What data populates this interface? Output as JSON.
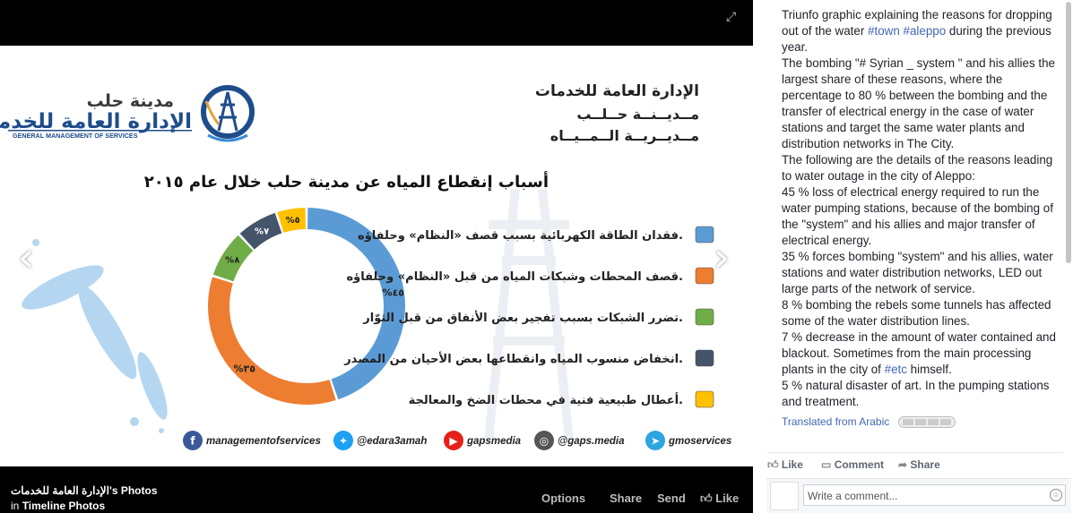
{
  "viewer": {
    "expand_icon": "expand-icon",
    "slide": {
      "brand_ar": "مدينة حلب",
      "brand_main_ar": "الإدارة العامة للخدمات",
      "brand_en": "GENERAL MANAGEMENT OF SERVICES",
      "header_lines": [
        "الإدارة العامة للخدمات",
        "مــديــنــة حــلــب",
        "مــديــريــة الــمــيــاه"
      ],
      "title": "أسباب إنقطاع المياه عن مدينة حلب خلال عام ٢٠١٥",
      "legend": [
        {
          "label": "فقدان الطاقة الكهربائية بسبب قصف «النظام» وحلفاؤه.",
          "color": "#5b9bd5"
        },
        {
          "label": "قصف المحطات وشبكات المياه من قبل «النظام» وحلفاؤه.",
          "color": "#ed7d31"
        },
        {
          "label": "تضرر الشبكات بسبب تفجير بعض الأنفاق من قبل الثوّار.",
          "color": "#70ad47"
        },
        {
          "label": "انخفاض منسوب المياه وانقطاعها بعض الأحيان من المصدر.",
          "color": "#44546a"
        },
        {
          "label": "أعطال طبيعية فنية في محطات الضخ والمعالجة.",
          "color": "#ffc000"
        }
      ],
      "social": [
        {
          "icon": "facebook-icon",
          "handle": "managementofservices",
          "color": "#3b5998"
        },
        {
          "icon": "twitter-icon",
          "handle": "@edara3amah",
          "color": "#1da1f2"
        },
        {
          "icon": "youtube-icon",
          "handle": "gapsmedia",
          "color": "#e62117"
        },
        {
          "icon": "instagram-icon",
          "handle": "@gaps.media",
          "color": "#555555"
        },
        {
          "icon": "telegram-icon",
          "handle": "gmoservices",
          "color": "#2ca5e0"
        }
      ]
    },
    "footer": {
      "album_title": "الإدارة العامة للخدمات's Photos",
      "album_in": "in",
      "album_name": "Timeline Photos",
      "options": "Options",
      "share": "Share",
      "send": "Send",
      "like": "Like"
    }
  },
  "chart_data": {
    "type": "pie",
    "categories": [
      "فقدان الطاقة الكهربائية",
      "قصف المحطات وشبكات المياه",
      "تضرر الشبكات",
      "انخفاض منسوب المياه",
      "أعطال طبيعية فنية"
    ],
    "values": [
      45,
      35,
      8,
      7,
      5
    ],
    "value_labels": [
      "%٤٥",
      "%٣٥",
      "%٨",
      "%٧",
      "%٥"
    ],
    "colors": [
      "#5b9bd5",
      "#ed7d31",
      "#70ad47",
      "#44546a",
      "#ffc000"
    ],
    "title": "أسباب إنقطاع المياه عن مدينة حلب خلال عام ٢٠١٥",
    "donut": true
  },
  "sidebar": {
    "caption": "Triunfo graphic explaining the reasons for dropping out of the water #town #aleppo during the previous year.\nThe bombing \"# Syrian _ system \" and his allies the largest share of these reasons, where the percentage to 80 % between the bombing and the transfer of electrical energy in the case of water stations and target the same water plants and distribution networks in The City.\nThe following are the details of the reasons leading to water outage in the city of Aleppo:\n45 % loss of electrical energy required to run the water pumping stations, because of the bombing of the \"system\" and his allies and major transfer of electrical energy.\n35 % forces bombing \"system\" and his allies, water stations and water distribution networks, LED out large parts of the network of service.\n8 % bombing the rebels some tunnels has affected some of the water distribution lines.\n7 % decrease in the amount of water contained and blackout. Sometimes from the main processing plants in the city of #etc himself.\n5 % natural disaster of art. In the pumping stations and treatment.",
    "translated": "Translated from Arabic",
    "actions": {
      "like": "Like",
      "comment": "Comment",
      "share": "Share"
    },
    "comment_placeholder": "Write a comment..."
  }
}
